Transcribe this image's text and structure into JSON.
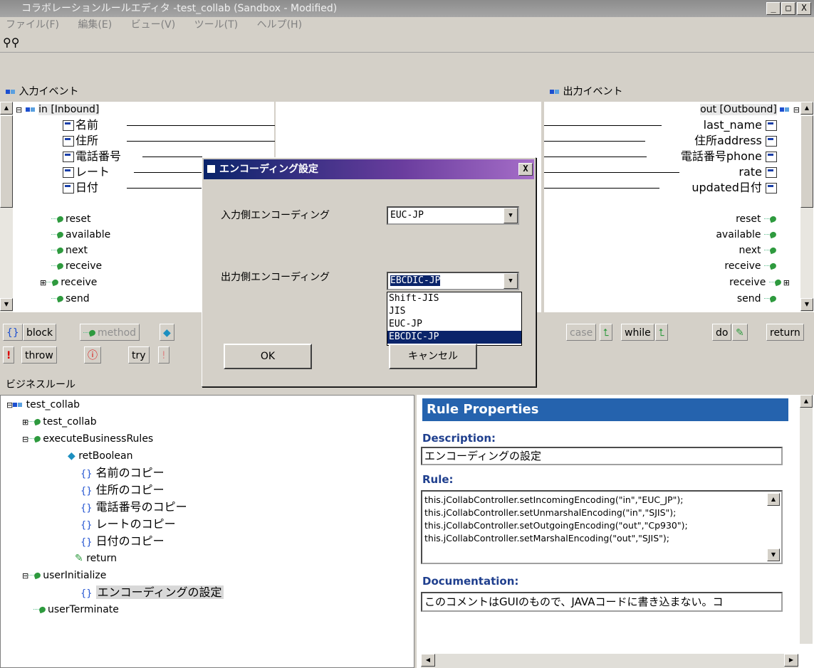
{
  "window": {
    "title": "コラボレーションルールエディタ -test_collab (Sandbox - Modified)",
    "min": "_",
    "max": "□",
    "close": "X"
  },
  "menu": [
    "ファイル(F)",
    "編集(E)",
    "ビュー(V)",
    "ツール(T)",
    "ヘルプ(H)"
  ],
  "input_panel": {
    "header": "入力イベント",
    "root": "in [Inbound]",
    "fields": [
      "名前",
      "住所",
      "電話番号",
      "レート",
      "日付"
    ],
    "methods": [
      "reset",
      "available",
      "next",
      "receive",
      "receive",
      "send"
    ]
  },
  "output_panel": {
    "header": "出力イベント",
    "root": "out [Outbound]",
    "fields": [
      "last_name",
      "住所address",
      "電話番号phone",
      "rate",
      "updated日付"
    ],
    "methods": [
      "reset",
      "available",
      "next",
      "receive",
      "receive",
      "send"
    ]
  },
  "blocks_row1": [
    "block",
    "method",
    "case",
    "while",
    "do",
    "return"
  ],
  "blocks_row2": [
    "throw",
    "try"
  ],
  "business_rules": {
    "header": "ビジネスルール",
    "root": "test_collab",
    "child": "test_collab",
    "execute": "executeBusinessRules",
    "rules": [
      "retBoolean",
      "名前のコピー",
      "住所のコピー",
      "電話番号のコピー",
      "レートのコピー",
      "日付のコピー",
      "return"
    ],
    "userInitialize": "userInitialize",
    "encoding_rule": "エンコーディングの設定",
    "userTerminate": "userTerminate"
  },
  "rule_properties": {
    "title": "Rule Properties",
    "description_label": "Description:",
    "description": "エンコーディングの設定",
    "rule_label": "Rule:",
    "rule_lines": [
      "this.jCollabController.setIncomingEncoding(\"in\",\"EUC_JP\");",
      "this.jCollabController.setUnmarshalEncoding(\"in\",\"SJIS\");",
      "this.jCollabController.setOutgoingEncoding(\"out\",\"Cp930\");",
      "this.jCollabController.setMarshalEncoding(\"out\",\"SJIS\");"
    ],
    "documentation_label": "Documentation:",
    "documentation": "このコメントはGUIのもので、JAVAコードに書き込まない。コ"
  },
  "dialog": {
    "title": "エンコーディング設定",
    "close": "X",
    "input_label": "入力側エンコーディング",
    "input_value": "EUC-JP",
    "output_label": "出力側エンコーディング",
    "output_value": "EBCDIC-JP",
    "options": [
      "Shift-JIS",
      "JIS",
      "EUC-JP",
      "EBCDIC-JP"
    ],
    "ok": "OK",
    "cancel": "キャンセル"
  }
}
